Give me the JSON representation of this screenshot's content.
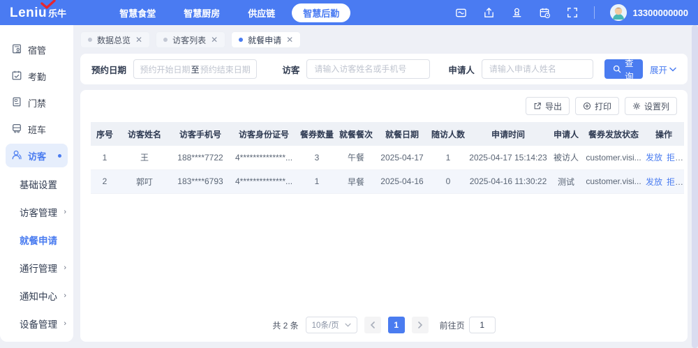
{
  "header": {
    "logo_text": "Leniu",
    "logo_cn": "乐牛",
    "nav": [
      {
        "label": "智慧食堂"
      },
      {
        "label": "智慧厨房"
      },
      {
        "label": "供应链"
      },
      {
        "label": "智慧后勤"
      }
    ],
    "phone": "13300000000"
  },
  "sidebar": {
    "items": [
      {
        "label": "宿管"
      },
      {
        "label": "考勤"
      },
      {
        "label": "门禁"
      },
      {
        "label": "班车"
      },
      {
        "label": "访客"
      }
    ],
    "submenu": [
      {
        "label": "基础设置"
      },
      {
        "label": "访客管理"
      },
      {
        "label": "就餐申请"
      },
      {
        "label": "通行管理"
      },
      {
        "label": "通知中心"
      },
      {
        "label": "设备管理"
      }
    ]
  },
  "tabs": [
    {
      "label": "数据总览"
    },
    {
      "label": "访客列表"
    },
    {
      "label": "就餐申请"
    }
  ],
  "filters": {
    "date_label": "预约日期",
    "date_start_placeholder": "预约开始日期",
    "date_separator": "至",
    "date_end_placeholder": "预约结束日期",
    "visitor_label": "访客",
    "visitor_placeholder": "请输入访客姓名或手机号",
    "applicant_label": "申请人",
    "applicant_placeholder": "请输入申请人姓名",
    "search_label": "查询",
    "expand_label": "展开"
  },
  "toolbar": {
    "export_label": "导出",
    "print_label": "打印",
    "columns_label": "设置列"
  },
  "table": {
    "headers": [
      "序号",
      "访客姓名",
      "访客手机号",
      "访客身份证号",
      "餐券数量",
      "就餐餐次",
      "就餐日期",
      "随访人数",
      "申请时间",
      "申请人",
      "餐券发放状态",
      "操作"
    ],
    "rows": [
      {
        "no": "1",
        "name": "王",
        "phone": "188****7722",
        "id_card": "4**************...",
        "ticket_count": "3",
        "meal": "午餐",
        "date": "2025-04-17",
        "companions": "1",
        "apply_time": "2025-04-17 15:14:23",
        "applicant": "被访人",
        "status": "customer.visi...",
        "actions": [
          "发放",
          "拒绝"
        ]
      },
      {
        "no": "2",
        "name": "郭叮",
        "phone": "183****6793",
        "id_card": "4**************...",
        "ticket_count": "1",
        "meal": "早餐",
        "date": "2025-04-16",
        "companions": "0",
        "apply_time": "2025-04-16 11:30:22",
        "applicant": "测试",
        "status": "customer.visi...",
        "actions": [
          "发放",
          "拒绝"
        ]
      }
    ]
  },
  "pagination": {
    "total": "共 2 条",
    "page_size": "10条/页",
    "current_page": "1",
    "goto_label": "前往页",
    "goto_value": "1"
  },
  "colors": {
    "header_bg": "#4a7bf2",
    "primary": "#4a7cf0",
    "link": "#4a7cf0",
    "page_bg": "#eef0f6",
    "stripe_row": "#f3f6fc",
    "table_header_bg": "#eef1f6",
    "active_item_bg": "#e6eefc",
    "logo_check": "#e8262d"
  }
}
